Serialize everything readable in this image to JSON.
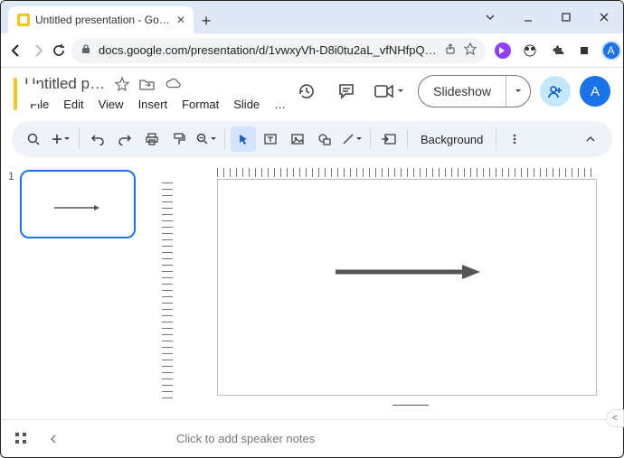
{
  "browser": {
    "tab_title": "Untitled presentation - Google S",
    "url": "docs.google.com/presentation/d/1vwxyVh-D8i0tu2aL_vfNHfpQ…",
    "avatar_letter": "A"
  },
  "doc": {
    "title": "Untitled p…",
    "menus": [
      "File",
      "Edit",
      "View",
      "Insert",
      "Format",
      "Slide",
      "…"
    ],
    "slideshow_label": "Slideshow",
    "avatar_letter": "A"
  },
  "toolbar": {
    "background_label": "Background"
  },
  "slides": {
    "current_number": "1"
  },
  "notes": {
    "placeholder": "Click to add speaker notes"
  }
}
